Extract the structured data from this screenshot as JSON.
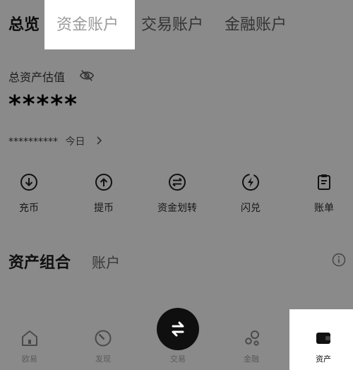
{
  "tabs": [
    {
      "label": "总览"
    },
    {
      "label": "资金账户"
    },
    {
      "label": "交易账户"
    },
    {
      "label": "金融账户"
    }
  ],
  "assets": {
    "label": "总资产估值",
    "value_masked": "*****",
    "sub_masked": "**********",
    "today_label": "今日"
  },
  "actions": [
    {
      "label": "充币",
      "icon": "deposit-icon"
    },
    {
      "label": "提币",
      "icon": "withdraw-icon"
    },
    {
      "label": "资金划转",
      "icon": "transfer-icon"
    },
    {
      "label": "闪兑",
      "icon": "flash-convert-icon"
    },
    {
      "label": "账单",
      "icon": "bill-icon"
    }
  ],
  "portfolio": {
    "title": "资产组合",
    "tab": "账户"
  },
  "bottom_nav": [
    {
      "label": "欧易",
      "icon": "home-icon"
    },
    {
      "label": "发现",
      "icon": "discover-icon"
    },
    {
      "label": "交易",
      "icon": "trade-swap-icon"
    },
    {
      "label": "金融",
      "icon": "finance-icon"
    },
    {
      "label": "资产",
      "icon": "wallet-icon"
    }
  ]
}
